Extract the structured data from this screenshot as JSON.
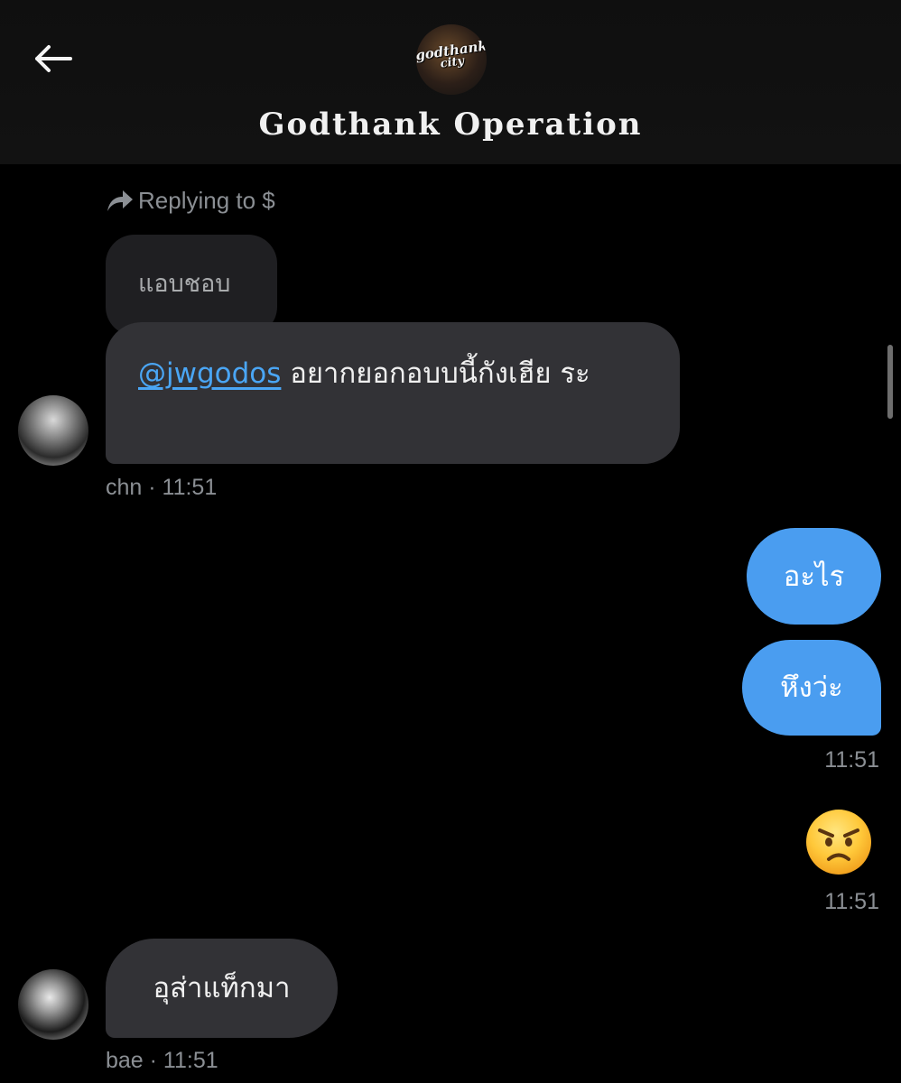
{
  "header": {
    "title": "Godthank Operation",
    "logo_text": "godthank",
    "logo_sub": "city"
  },
  "reply": {
    "label": "Replying to $",
    "quoted_text": "แอบชอบ"
  },
  "messages": [
    {
      "mention": "@jwgodos",
      "text": " อยากยอกอบบนี้กังเฮีย ระ",
      "meta": "chn · 11:51"
    },
    {
      "text": "อะไร"
    },
    {
      "text": "หึงว่ะ",
      "meta": "11:51"
    },
    {
      "emoji": "angry-face",
      "meta": "11:51"
    },
    {
      "text": "อุส่าแท็กมา",
      "meta": "bae · 11:51"
    }
  ],
  "colors": {
    "background": "#000000",
    "incoming_bubble": "#323236",
    "outgoing_bubble": "#4a9df0",
    "mention": "#4aa6f5",
    "meta_text": "#8b8f94"
  }
}
